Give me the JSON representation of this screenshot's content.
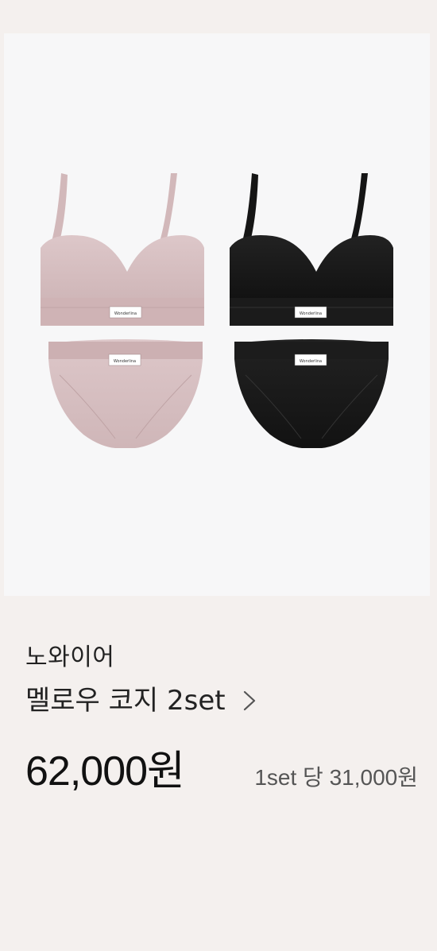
{
  "product": {
    "brand": "노와이어",
    "title": "멜로우 코지 2set",
    "price": "62,000원",
    "unit_price": "1set 당 31,000원",
    "image_label": "Wonderlina",
    "colors": {
      "blush": "#d9c3c5",
      "black": "#1a1a1a",
      "background": "#f4f0ee",
      "card": "#f7f7f8"
    },
    "icons": {
      "more": "chevron-right-icon"
    }
  }
}
